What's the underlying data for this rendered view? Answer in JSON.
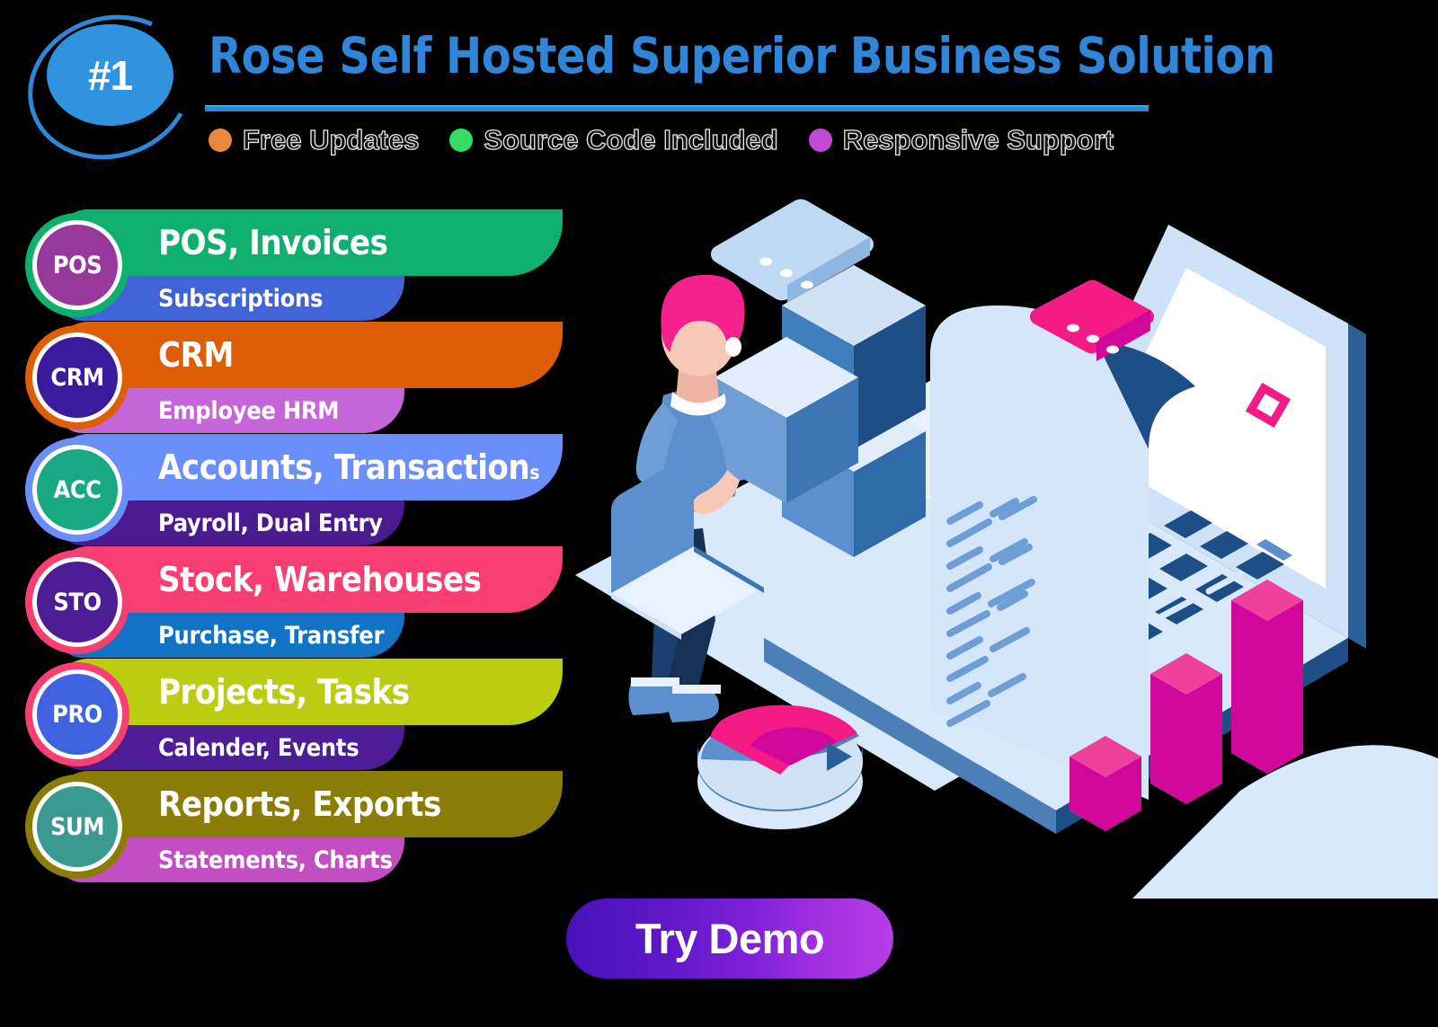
{
  "header": {
    "rank_badge": "#1",
    "title": "Rose Self Hosted Superior Business Solution",
    "pills": [
      {
        "label": "Free Updates",
        "icon": "dot-icon",
        "color": "#e8883a"
      },
      {
        "label": "Source Code Included",
        "icon": "dot-icon",
        "color": "#33dd66"
      },
      {
        "label": "Responsive Support",
        "icon": "dot-icon",
        "color": "#c04ad6"
      }
    ],
    "rule_color": "#2f86d8",
    "title_color": "#2f86d8"
  },
  "features": [
    {
      "badge": "POS",
      "title": "POS, Invoices",
      "title_overflow": "",
      "subtitle": "Subscriptions",
      "bar_color": "#0faf6e",
      "sub_color": "#4163d8",
      "badge_color": "#96399a",
      "ring_color": "#0faf6e"
    },
    {
      "badge": "CRM",
      "title": "CRM",
      "title_overflow": "",
      "subtitle": "Employee HRM",
      "bar_color": "#de5e06",
      "sub_color": "#c566d8",
      "badge_color": "#3a1b9e",
      "ring_color": "#de5e06"
    },
    {
      "badge": "ACC",
      "title": "Accounts, Transaction",
      "title_overflow": "s",
      "subtitle": "Payroll, Dual Entry",
      "bar_color": "#6a8efc",
      "sub_color": "#4a1b8e",
      "badge_color": "#18a883",
      "ring_color": "#6a8efc"
    },
    {
      "badge": "STO",
      "title": "Stock, Warehouses",
      "title_overflow": "",
      "subtitle": "Purchase, Transfer",
      "bar_color": "#f93e72",
      "sub_color": "#1272c4",
      "badge_color": "#4c1d94",
      "ring_color": "#f93e72"
    },
    {
      "badge": "PRO",
      "title": "Projects, Tasks",
      "title_overflow": "",
      "subtitle": "Calender, Events",
      "bar_color": "#bccc10",
      "sub_color": "#4c1d94",
      "badge_color": "#3f63e0",
      "ring_color": "#f93e72"
    },
    {
      "badge": "SUM",
      "title": "Reports, Exports",
      "title_overflow": "",
      "subtitle": "Statements, Charts",
      "bar_color": "#8a7c06",
      "sub_color": "#c34ec4",
      "badge_color": "#3a9a92",
      "ring_color": "#8a7c06"
    }
  ],
  "cta": {
    "label": "Try Demo",
    "gradient_from": "#4611b8",
    "gradient_to": "#b63ce6"
  },
  "illustration": {
    "name": "isometric-business-dashboard",
    "elements": [
      "laptop",
      "receipt-scroll",
      "person-with-laptop",
      "chat-bubble-blue",
      "chat-bubble-pink",
      "bar-chart-3-bars",
      "donut-pie-chart",
      "stacked-blocks",
      "diamond-accent",
      "dash-accent"
    ],
    "palette": {
      "paper": "#d4e6fa",
      "paper_light": "#e8f2fd",
      "blue_mid": "#5b8fd0",
      "blue_deep": "#1d4e86",
      "blue_dark": "#17406f",
      "white": "#ffffff",
      "pink": "#f01f85",
      "magenta": "#d1069a",
      "hair_pink": "#f5218c",
      "skin": "#f6c8b6",
      "shirt": "#5b8fd0",
      "jeans": "#1b3f6e"
    },
    "bar_chart_heights": [
      60,
      130,
      185
    ],
    "donut_segments": [
      40,
      60
    ]
  }
}
